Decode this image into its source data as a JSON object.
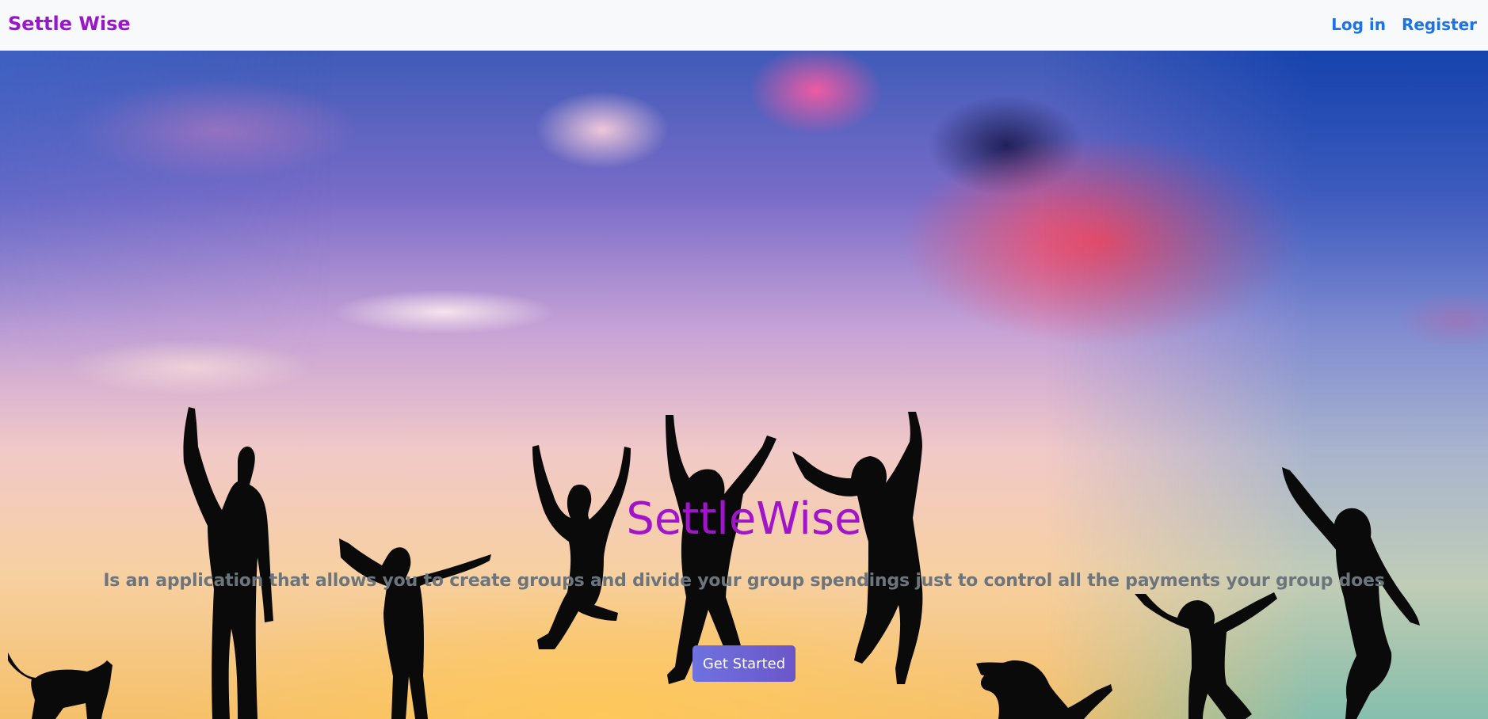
{
  "navbar": {
    "brand": "Settle Wise",
    "links": {
      "login": "Log in",
      "register": "Register"
    }
  },
  "hero": {
    "title": "SettleWise",
    "subtitle": "Is an application that allows you to create groups and divide your group spendings just to control all the payments your group does",
    "cta_label": "Get Started"
  },
  "colors": {
    "brand": "#9a16c9",
    "nav_link": "#1a73e8",
    "title": "#a114c9",
    "subtitle": "#6c757d",
    "cta_start": "#6f72e0",
    "cta_end": "#6b56c8"
  }
}
